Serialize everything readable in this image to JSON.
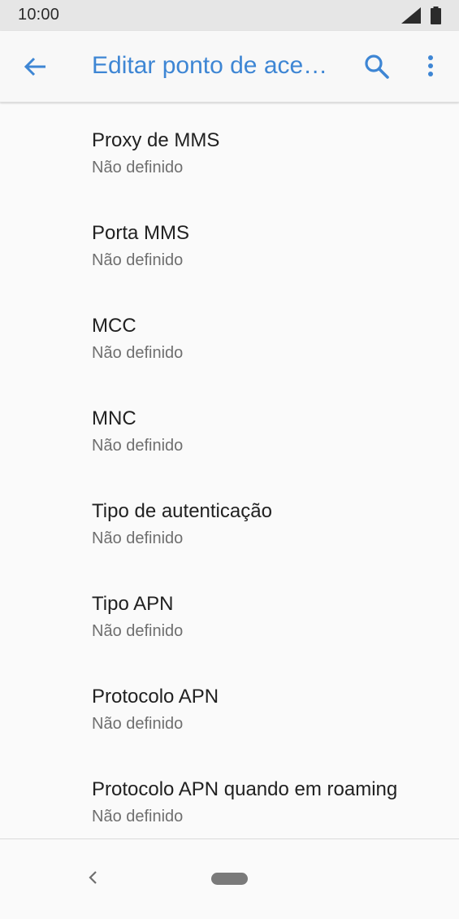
{
  "status_bar": {
    "time": "10:00",
    "signal_icon": "cell-signal-icon",
    "battery_icon": "battery-icon"
  },
  "app_bar": {
    "back_icon": "arrow-back-icon",
    "title": "Editar ponto de ace…",
    "search_icon": "search-icon",
    "more_icon": "more-vert-icon"
  },
  "settings": {
    "items": [
      {
        "title": "Proxy de MMS",
        "value": "Não definido"
      },
      {
        "title": "Porta MMS",
        "value": "Não definido"
      },
      {
        "title": "MCC",
        "value": "Não definido"
      },
      {
        "title": "MNC",
        "value": "Não definido"
      },
      {
        "title": "Tipo de autenticação",
        "value": "Não definido"
      },
      {
        "title": "Tipo APN",
        "value": "Não definido"
      },
      {
        "title": "Protocolo APN",
        "value": "Não definido"
      },
      {
        "title": "Protocolo APN quando em roaming",
        "value": "Não definido"
      }
    ]
  },
  "nav_bar": {
    "back_icon": "nav-back-chevron-icon",
    "home_icon": "home-pill-icon"
  },
  "colors": {
    "accent": "#3e86d4",
    "status_bar_bg": "#e6e6e6",
    "background": "#fafafa",
    "primary_text": "#212121",
    "secondary_text": "#6f6f6f"
  }
}
